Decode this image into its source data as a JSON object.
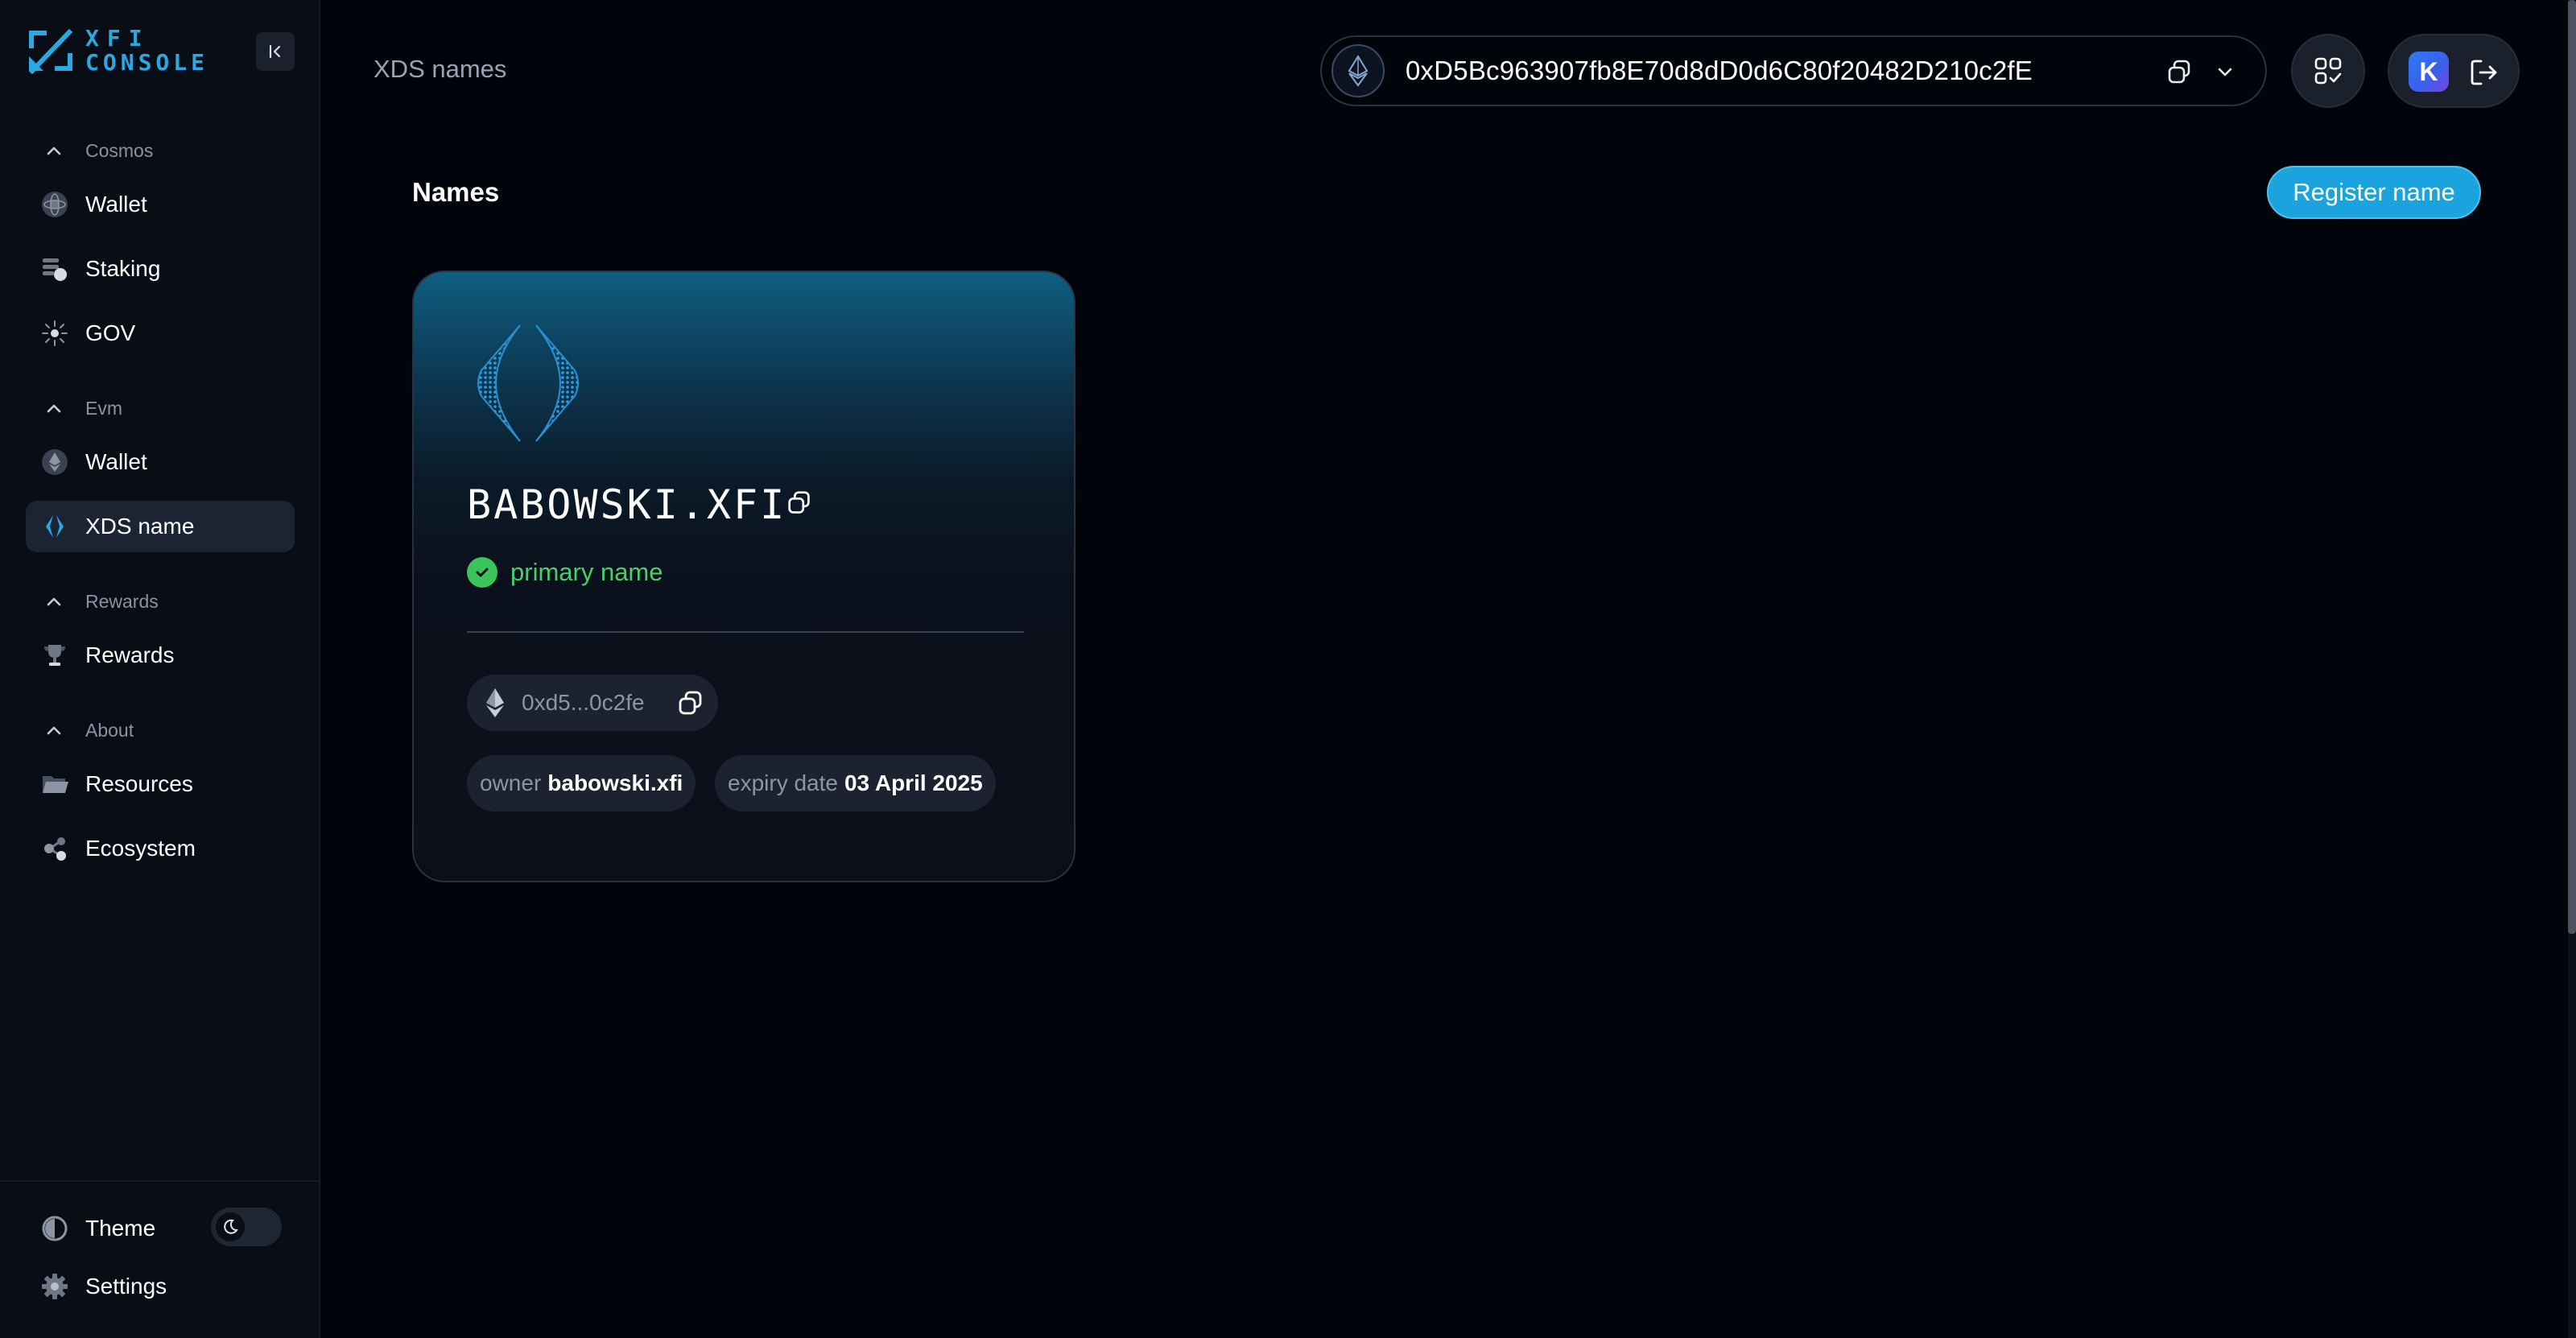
{
  "app": {
    "logo_line1": "XFI",
    "logo_line2": "CONSOLE"
  },
  "sidebar": {
    "sections": [
      {
        "label": "Cosmos",
        "items": [
          {
            "label": "Wallet",
            "icon": "cosmos-wallet-icon"
          },
          {
            "label": "Staking",
            "icon": "staking-icon"
          },
          {
            "label": "GOV",
            "icon": "gov-icon"
          }
        ]
      },
      {
        "label": "Evm",
        "items": [
          {
            "label": "Wallet",
            "icon": "evm-wallet-icon"
          },
          {
            "label": "XDS name",
            "icon": "xds-name-icon",
            "active": true
          }
        ]
      },
      {
        "label": "Rewards",
        "items": [
          {
            "label": "Rewards",
            "icon": "trophy-icon"
          }
        ]
      },
      {
        "label": "About",
        "items": [
          {
            "label": "Resources",
            "icon": "folder-icon"
          },
          {
            "label": "Ecosystem",
            "icon": "ecosystem-icon"
          }
        ]
      }
    ],
    "footer": {
      "theme_label": "Theme",
      "settings_label": "Settings"
    }
  },
  "header": {
    "breadcrumb": "XDS names",
    "wallet_address": "0xD5Bc963907fb8E70d8dD0d6C80f20482D210c2fE",
    "avatar_letter": "K"
  },
  "main": {
    "title": "Names",
    "register_button": "Register name",
    "card": {
      "name": "BABOWSKI.XFI",
      "status": "primary name",
      "short_address": "0xd5...0c2fe",
      "owner_label": "owner",
      "owner_value": "babowski.xfi",
      "expiry_label": "expiry date",
      "expiry_value": "03 April 2025"
    }
  },
  "colors": {
    "background": "#02040c",
    "sidebar": "#090d16",
    "accent": "#1aa3dc",
    "success": "#3bc45b"
  }
}
